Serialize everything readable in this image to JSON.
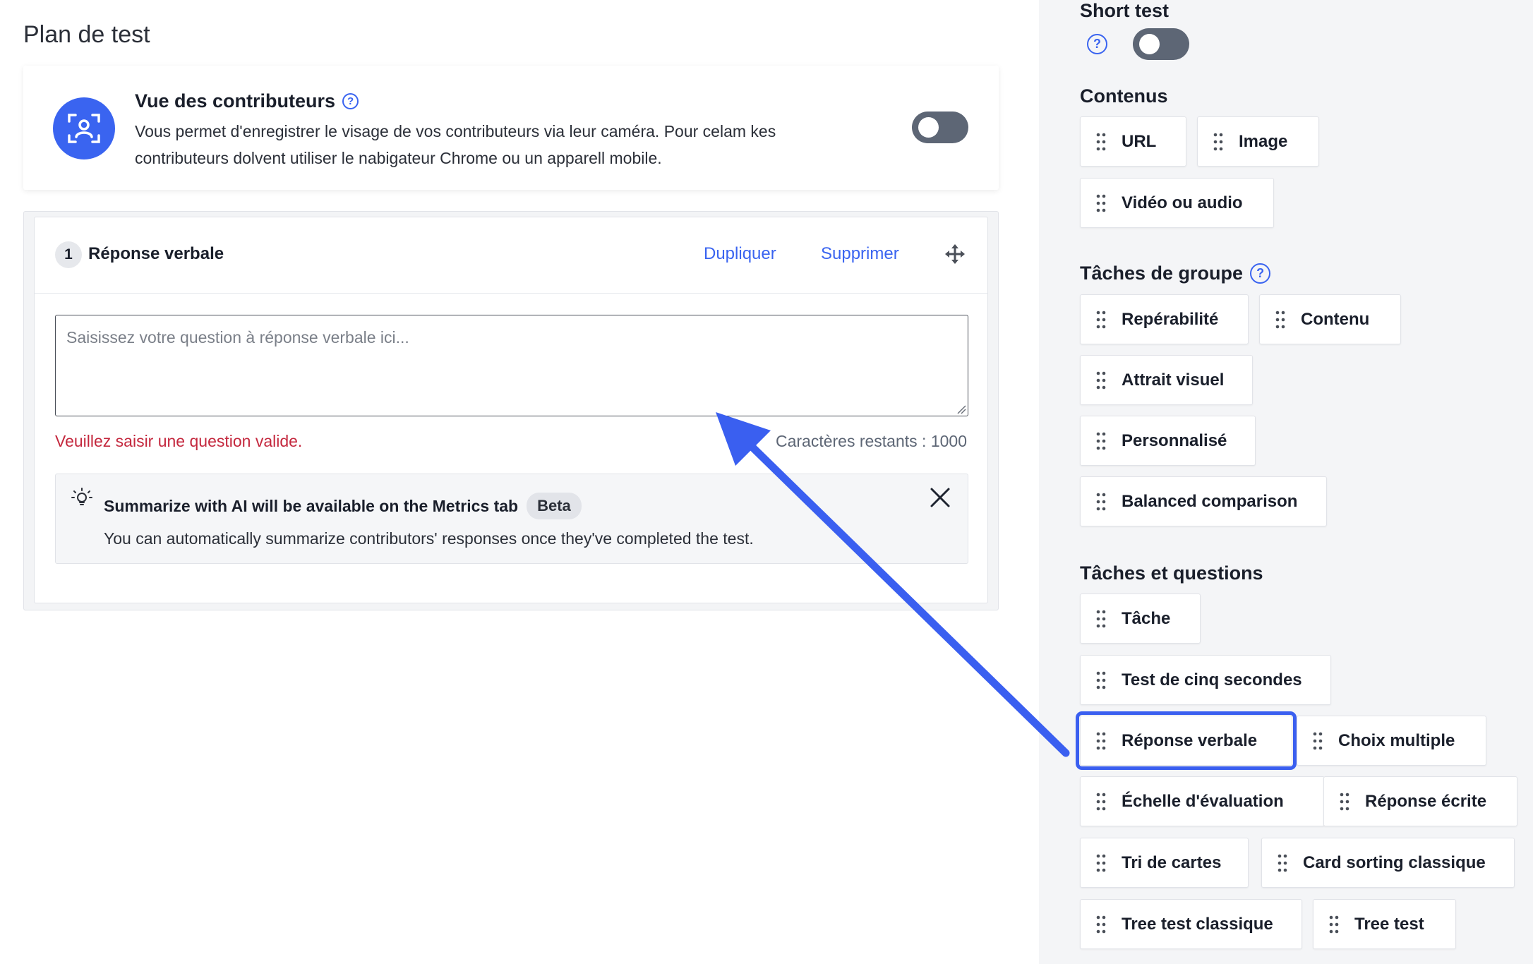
{
  "main": {
    "page_title": "Plan de test",
    "contributor_view": {
      "title": "Vue des contributeurs",
      "description": "Vous permet d'enregistrer le visage de vos contributeurs via leur caméra. Pour celam kes contributeurs dolvent utiliser le nabigateur Chrome ou un apparell mobile.",
      "toggle_on": false
    },
    "question": {
      "number": "1",
      "title": "Réponse verbale",
      "duplicate_label": "Dupliquer",
      "delete_label": "Supprimer",
      "input_placeholder": "Saisissez votre question à réponse verbale ici...",
      "error": "Veuillez saisir une question valide.",
      "remaining": "Caractères restants : 1000",
      "ai_notice": {
        "title": "Summarize with AI will be available on the Metrics tab",
        "badge": "Beta",
        "description": "You can automatically summarize contributors' responses once they've completed the test."
      }
    }
  },
  "sidebar": {
    "short_test": {
      "label": "Short test",
      "toggle_on": false
    },
    "contenus": {
      "heading": "Contenus",
      "items": [
        "URL",
        "Image",
        "Vidéo ou audio"
      ]
    },
    "taches_groupe": {
      "heading": "Tâches de groupe",
      "items": [
        "Repérabilité",
        "Contenu",
        "Attrait visuel",
        "Personnalisé",
        "Balanced comparison"
      ]
    },
    "taches_questions": {
      "heading": "Tâches et questions",
      "items": [
        "Tâche",
        "Test de cinq secondes",
        "Réponse verbale",
        "Choix multiple",
        "Échelle d'évaluation",
        "Réponse écrite",
        "Tri de cartes",
        "Card sorting classique",
        "Tree test classique",
        "Tree test"
      ],
      "highlighted": "Réponse verbale"
    }
  },
  "colors": {
    "accent": "#3a64f0",
    "error": "#c4283e",
    "toggle_off": "#5d6675",
    "annotation_arrow": "#3a5ff0"
  }
}
